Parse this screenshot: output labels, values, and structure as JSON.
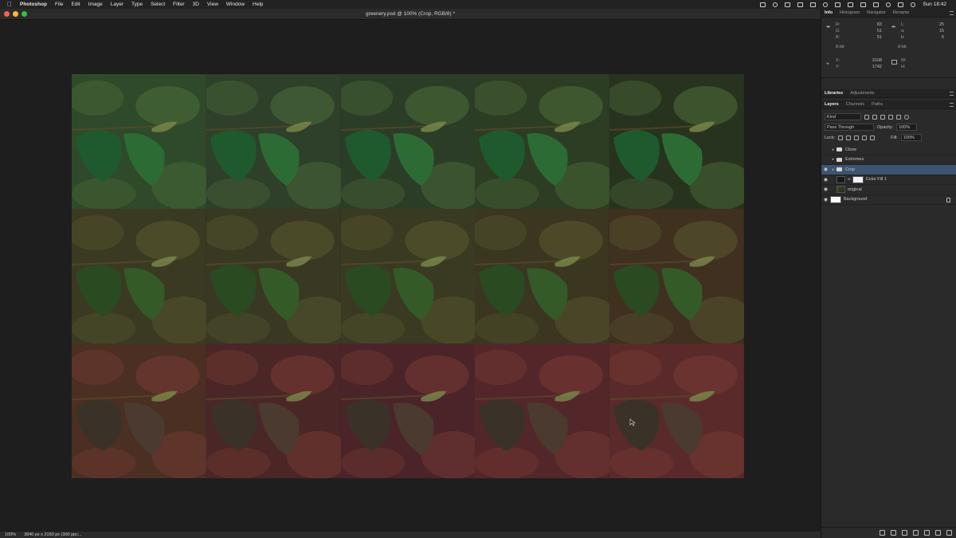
{
  "menubar": {
    "app_name": "Photoshop",
    "items": [
      "File",
      "Edit",
      "Image",
      "Layer",
      "Type",
      "Select",
      "Filter",
      "3D",
      "View",
      "Window",
      "Help"
    ],
    "clock": "Sun 18:42"
  },
  "document": {
    "title": "greenery.psd @ 100% (Crop, RGB/8) *"
  },
  "status": {
    "zoom": "100%",
    "doc_info": "3840 px x 2160 px (300 ppc..."
  },
  "info_panel": {
    "tabs": [
      "Info",
      "Histogram",
      "Navigator",
      "Rename"
    ],
    "rgb": {
      "r_label": "R:",
      "g_label": "G:",
      "b_label": "B:",
      "r": "83",
      "g": "51",
      "b": "51"
    },
    "lab": {
      "l_label": "L:",
      "a_label": "a:",
      "b_label": "b:",
      "l": "25",
      "a": "15",
      "b": "6"
    },
    "bit_left": "8-bit",
    "bit_right": "8-bit",
    "xy": {
      "x_label": "X:",
      "y_label": "Y:",
      "x": "3108",
      "y": "1742"
    },
    "wh": {
      "w_label": "W:",
      "h_label": "H:"
    }
  },
  "libraries_panel": {
    "tabs": [
      "Libraries",
      "Adjustments"
    ]
  },
  "layers_panel": {
    "tabs": [
      "Layers",
      "Channels",
      "Paths"
    ],
    "filter_kind": "Kind",
    "blend_mode": "Pass Through",
    "opacity_label": "Opacity:",
    "opacity_value": "100%",
    "lock_label": "Lock:",
    "fill_label": "Fill:",
    "fill_value": "100%",
    "layers": [
      {
        "name": "Close",
        "type": "group",
        "visible": false,
        "selected": false
      },
      {
        "name": "Extremes",
        "type": "group",
        "visible": false,
        "selected": false
      },
      {
        "name": "Crop",
        "type": "group",
        "visible": true,
        "selected": true
      },
      {
        "name": "Color Fill 1",
        "type": "fill",
        "visible": true,
        "selected": false
      },
      {
        "name": "original",
        "type": "image",
        "visible": true,
        "selected": false
      },
      {
        "name": "Background",
        "type": "background",
        "visible": true,
        "selected": false
      }
    ]
  },
  "tiles": {
    "colors": [
      [
        "#2f4a2a",
        "#2e3f2a",
        "#2c3d27",
        "#2d3d23",
        "#28331f"
      ],
      [
        "#3a3a22",
        "#383823",
        "#3a3a22",
        "#3a3620",
        "#3f3020"
      ],
      [
        "#4a2f22",
        "#4a2726",
        "#4a2429",
        "#53272a",
        "#5a2a2a"
      ]
    ]
  }
}
